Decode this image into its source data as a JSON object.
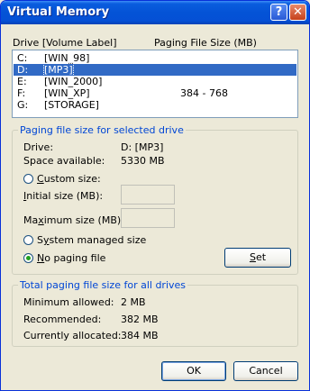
{
  "window": {
    "title": "Virtual Memory",
    "help_glyph": "?",
    "close_glyph": "✕"
  },
  "drive_list": {
    "col_drive": "Drive  [Volume Label]",
    "col_paging": "Paging File Size (MB)",
    "rows": [
      {
        "letter": "C:",
        "label": "[WIN_98]",
        "size": ""
      },
      {
        "letter": "D:",
        "label": "[MP3]",
        "size": ""
      },
      {
        "letter": "E:",
        "label": "[WIN_2000]",
        "size": ""
      },
      {
        "letter": "F:",
        "label": "[WIN_XP]",
        "size": "384 - 768"
      },
      {
        "letter": "G:",
        "label": "[STORAGE]",
        "size": ""
      }
    ],
    "selected_index": 1
  },
  "selected_drive": {
    "legend": "Paging file size for selected drive",
    "drive_label": "Drive:",
    "drive_value": "D:  [MP3]",
    "space_label": "Space available:",
    "space_value": "5330 MB",
    "custom_size": {
      "pre": "",
      "key": "C",
      "post": "ustom size:"
    },
    "initial_size": {
      "pre": "",
      "key": "I",
      "post": "nitial size (MB):"
    },
    "maximum_size": {
      "pre": "Ma",
      "key": "x",
      "post": "imum size (MB):"
    },
    "system_managed": {
      "pre": "S",
      "key": "y",
      "post": "stem managed size"
    },
    "no_paging": {
      "pre": "",
      "key": "N",
      "post": "o paging file"
    },
    "selected_option": "no_paging",
    "set_button": {
      "pre": "",
      "key": "S",
      "post": "et"
    }
  },
  "totals": {
    "legend": "Total paging file size for all drives",
    "min_label": "Minimum allowed:",
    "min_value": "2 MB",
    "rec_label": "Recommended:",
    "rec_value": "382 MB",
    "cur_label": "Currently allocated:",
    "cur_value": "384 MB"
  },
  "buttons": {
    "ok": "OK",
    "cancel": "Cancel"
  },
  "colors": {
    "title_blue": "#0453D6",
    "selection": "#316AC5",
    "legend_text": "#0046D5",
    "dialog_bg": "#ECE9D8"
  }
}
